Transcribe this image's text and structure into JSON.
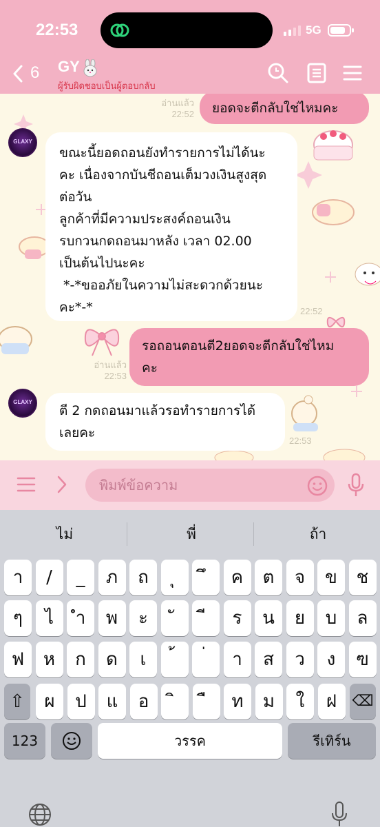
{
  "status": {
    "time": "22:53",
    "network": "5G",
    "battery_level": 0.8
  },
  "header": {
    "back_count": "6",
    "chat_name": "GY",
    "subtitle": "ผู้รับผิดชอบเป็นผู้ตอบกลับ",
    "icons": [
      "search-icon",
      "notes-icon",
      "menu-icon"
    ]
  },
  "messages": [
    {
      "side": "out",
      "read": "อ่านแล้ว",
      "time": "22:52",
      "text": "ยอดจะตีกลับใช่ไหมคะ"
    },
    {
      "side": "in",
      "time": "22:52",
      "lines": [
        "ขณะนี้ยอดถอนยังทำรายการไม่ได้นะ",
        "คะ เนื่องจากบันชีถอนเต็มวงเงินสูงสุด",
        "ต่อวัน",
        "ลูกค้าที่มีความประสงค์ถอนเงิน",
        "รบกวนกดถอนมาหลัง เวลา 02.00",
        "เป็นต้นไปนะคะ",
        " *-*ขออภัยในความไม่สะดวกด้วยนะ",
        "คะ*-*"
      ]
    },
    {
      "side": "out",
      "read": "อ่านแล้ว",
      "time": "22:53",
      "lines": [
        "รอถอนตอนตี2ยอดจะตีกลับใช่ไหม",
        "คะ"
      ]
    },
    {
      "side": "in",
      "time": "22:53",
      "lines": [
        "ตี 2 กดถอนมาแล้วรอทำรายการได้",
        "เลยคะ"
      ]
    }
  ],
  "avatar_label": "GLAXY",
  "input": {
    "placeholder": "พิมพ์ข้อความ"
  },
  "keyboard": {
    "suggestions": [
      "ไม่",
      "พี่",
      "ถ้า"
    ],
    "row1": [
      "า",
      "/",
      "_",
      "ภ",
      "ถ",
      "ุ",
      "ึ",
      "ค",
      "ต",
      "จ",
      "ข",
      "ช"
    ],
    "row2": [
      "ๆ",
      "ไ",
      "ำ",
      "พ",
      "ะ",
      "ั",
      "ี",
      "ร",
      "น",
      "ย",
      "บ",
      "ล"
    ],
    "row3": [
      "ฟ",
      "ห",
      "ก",
      "ด",
      "เ",
      "้",
      "่",
      "า",
      "ส",
      "ว",
      "ง",
      "ฃ"
    ],
    "row4": [
      "ผ",
      "ป",
      "แ",
      "อ",
      "ิ",
      "ื",
      "ท",
      "ม",
      "ใ",
      "ฝ"
    ],
    "shift": "⇧",
    "delete": "⌫",
    "numbers": "123",
    "space": "วรรค",
    "return": "รีเทิร์น"
  }
}
